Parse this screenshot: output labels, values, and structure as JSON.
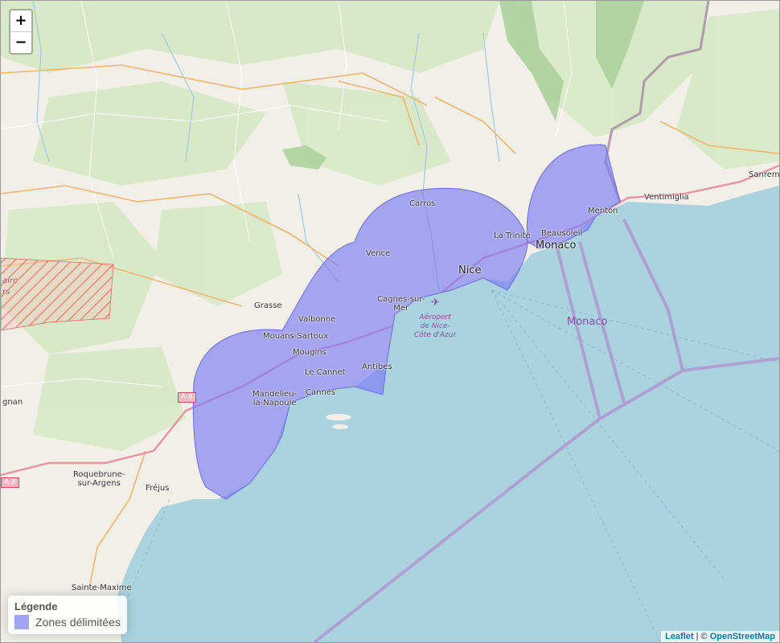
{
  "zoom_controls": {
    "zoom_in": "+",
    "zoom_out": "−"
  },
  "legend": {
    "title": "Légende",
    "items": [
      {
        "label": "Zones délimitées",
        "color": "#7b7bf6"
      }
    ]
  },
  "attribution": {
    "leaflet": "Leaflet",
    "separator": " | © ",
    "osm": "OpenStreetMap"
  },
  "colors": {
    "sea": "#aad3df",
    "land": "#f2efe9",
    "zone": "#7b7bf6",
    "maritime_border": "#b08ac8",
    "road_motorway": "#e892a2",
    "road_primary": "#fcd6a4",
    "forest": "#c8e6b0"
  },
  "places": {
    "carros": "Carros",
    "vence": "Vence",
    "nice": "Nice",
    "la_trinite": "La Trinité",
    "beausoleil": "Beausoleil",
    "monaco": "Monaco",
    "menton": "Menton",
    "ventimiglia": "Ventimiglia",
    "sanremo": "Sanremo",
    "grasse": "Grasse",
    "cagnes": "Cagnes-sur-\nMer",
    "valbonne": "Valbonne",
    "mouans": "Mouans-Sartoux",
    "mougins": "Mougins",
    "le_cannet": "Le Cannet",
    "antibes": "Antibes",
    "mandelieu": "Mandelieu-\nla-Napoule",
    "cannes": "Cannes",
    "roquebrune": "Roquebrune-\nsur-Argens",
    "frejus": "Fréjus",
    "sainte_maxime": "Sainte-Maxime",
    "gnan": "gnan",
    "airport": "Aéroport\nde Nice-\nCôte d'Azur",
    "monaco_sea": "Monaco",
    "aire": "aire",
    "rs": "rs",
    "a8_a": "A 8",
    "a8_b": "A 8"
  }
}
